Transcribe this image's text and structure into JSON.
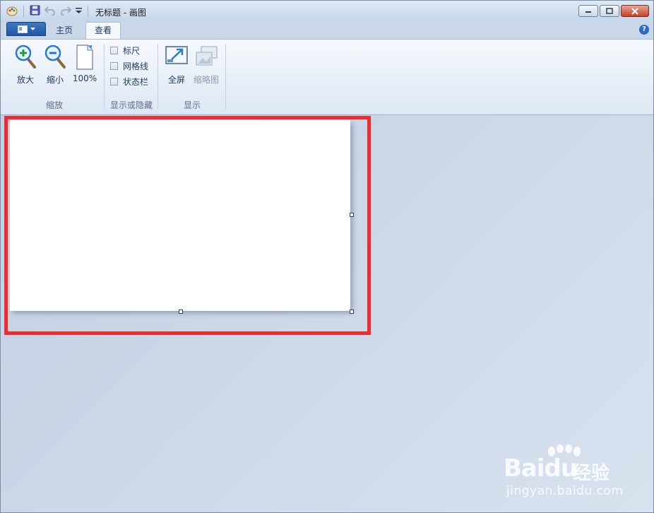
{
  "window": {
    "title": "无标题 - 画图"
  },
  "tabs": [
    {
      "label": "主页",
      "active": false
    },
    {
      "label": "查看",
      "active": true
    }
  ],
  "ribbon": {
    "zoom": {
      "title": "缩放",
      "zoom_in_label": "放大",
      "zoom_out_label": "缩小",
      "actual_size_label": "100%"
    },
    "show_hide": {
      "title": "显示或隐藏",
      "rulers_label": "标尺",
      "gridlines_label": "网格线",
      "statusbar_label": "状态栏",
      "rulers_checked": false,
      "gridlines_checked": false,
      "statusbar_checked": false
    },
    "display": {
      "title": "显示",
      "fullscreen_label": "全屏",
      "thumbnail_label": "缩略图"
    }
  },
  "watermark": {
    "brand_text": "Baidu",
    "product_text": "经验",
    "url": "jingyan.baidu.com"
  },
  "colors": {
    "highlight": "#ee2b2f",
    "accent": "#2a6bc2"
  }
}
